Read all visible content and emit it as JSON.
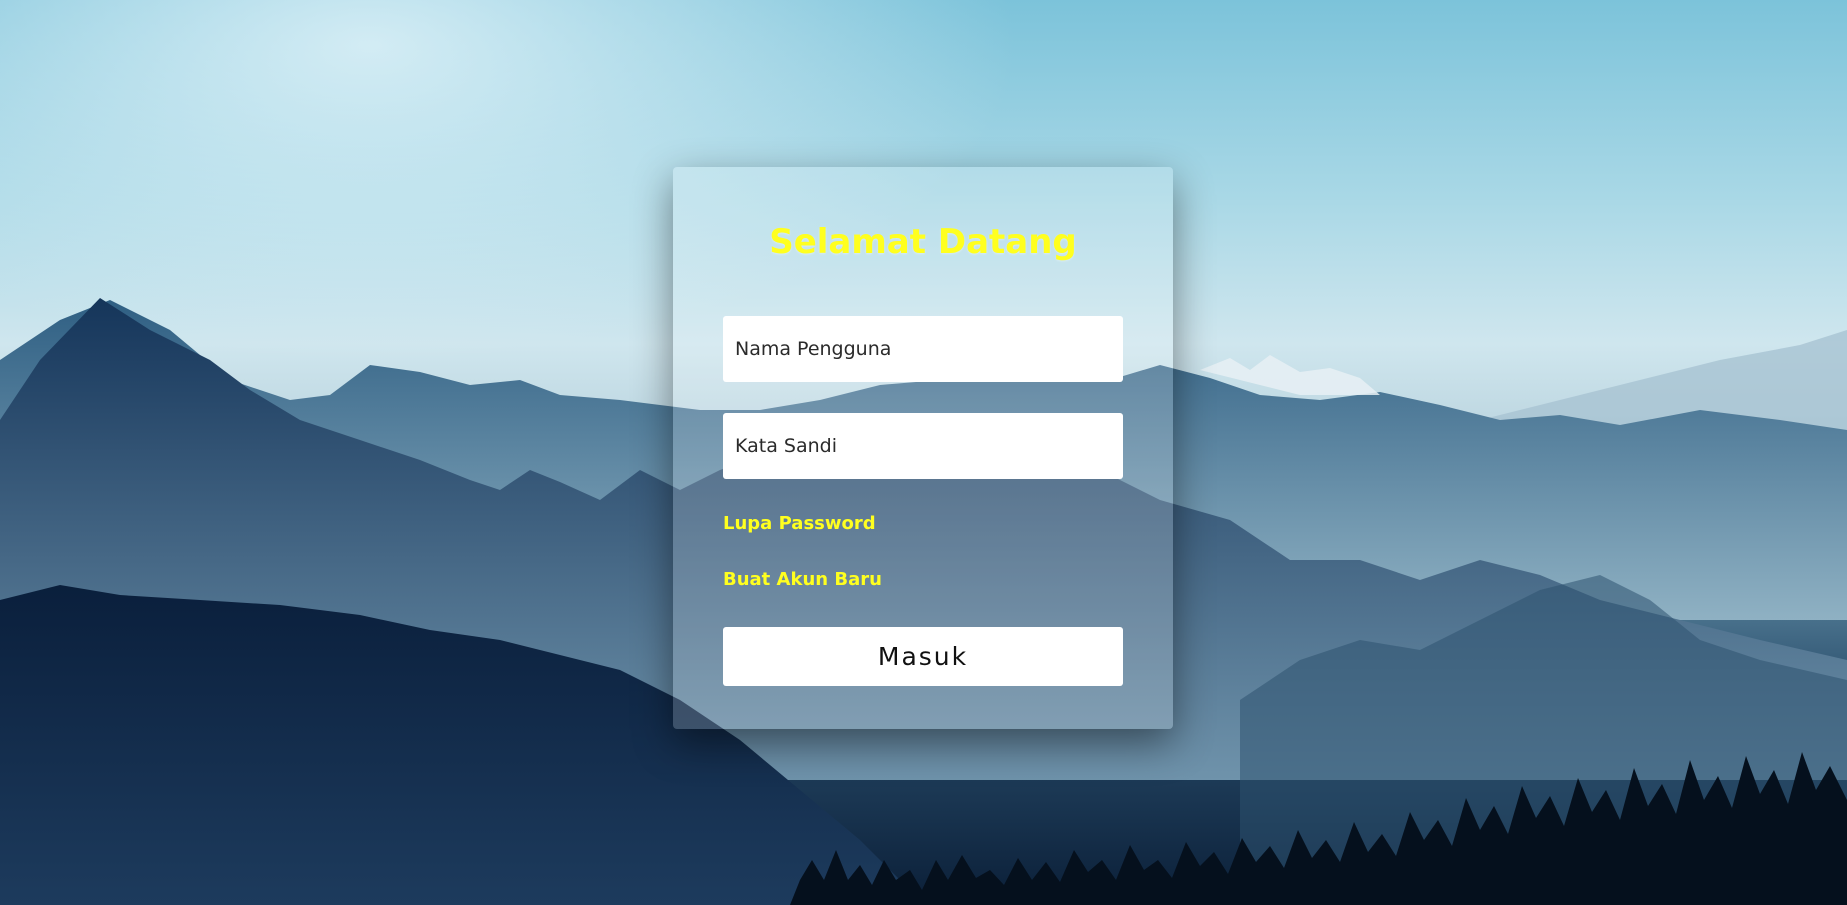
{
  "login": {
    "title": "Selamat Datang",
    "username_placeholder": "Nama Pengguna",
    "password_placeholder": "Kata Sandi",
    "forgot_password_label": "Lupa Password",
    "create_account_label": "Buat Akun Baru",
    "submit_label": "Masuk"
  },
  "colors": {
    "accent_yellow": "#ffff1f",
    "input_background": "#ffffff",
    "sky": "#a9d8e6",
    "mountain_dark": "#0b1f38"
  }
}
